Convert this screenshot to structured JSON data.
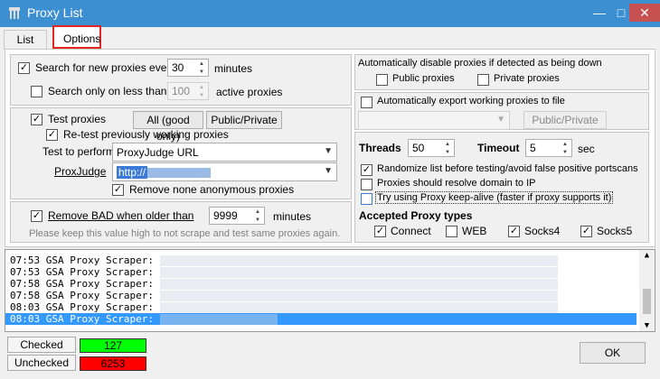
{
  "window": {
    "title": "Proxy List",
    "controls": [
      "minimize-icon",
      "maximize-icon",
      "close-icon"
    ],
    "titlebar_color": "#3c8fd1"
  },
  "tabs": [
    {
      "label": "List",
      "active": false
    },
    {
      "label": "Options",
      "active": true
    }
  ],
  "search": {
    "search_new_label": "Search for new proxies every",
    "search_new_checked": true,
    "search_new_value": "30",
    "search_new_unit": "minutes",
    "search_less_label": "Search only on less than",
    "search_less_checked": false,
    "search_less_value": "100",
    "search_less_unit": "active proxies"
  },
  "test": {
    "test_label": "Test proxies",
    "test_checked": true,
    "all_good_button": "All (good only)",
    "public_private_button": "Public/Private",
    "retest_label": "Re-test previously working proxies",
    "retest_checked": true,
    "test_to_perform_label": "Test to perform",
    "test_to_perform_value": "ProxyJudge URL",
    "proxyjudge_label": "ProxJudge",
    "proxyjudge_value": "http://",
    "remove_anon_label": "Remove none anonymous proxies",
    "remove_anon_checked": true
  },
  "remove_bad": {
    "label": "Remove BAD when older than",
    "checked": true,
    "value": "9999",
    "unit": "minutes",
    "hint": "Please keep this value high to not scrape and test same proxies again."
  },
  "auto_disable": {
    "label": "Automatically disable proxies if detected as being down",
    "public_label": "Public proxies",
    "public_checked": false,
    "private_label": "Private proxies",
    "private_checked": false
  },
  "auto_export": {
    "label": "Automatically export working proxies to file",
    "checked": false,
    "public_private_button": "Public/Private"
  },
  "threads": {
    "threads_label": "Threads",
    "threads_value": "50",
    "timeout_label": "Timeout",
    "timeout_value": "5",
    "timeout_unit": "sec"
  },
  "options": {
    "randomize_label": "Randomize list before testing/avoid false positive portscans",
    "randomize_checked": true,
    "resolve_label": "Proxies should resolve domain to IP",
    "resolve_checked": false,
    "keepalive_label": "Try using Proxy keep-alive (faster if proxy supports it)",
    "keepalive_checked": false
  },
  "accepted_types": {
    "title": "Accepted Proxy types",
    "connect_label": "Connect",
    "connect_checked": true,
    "web_label": "WEB",
    "web_checked": false,
    "socks4_label": "Socks4",
    "socks4_checked": true,
    "socks5_label": "Socks5",
    "socks5_checked": true
  },
  "log": {
    "lines": [
      "07:53 GSA Proxy Scraper:",
      "07:53 GSA Proxy Scraper:",
      "07:58 GSA Proxy Scraper:",
      "07:58 GSA Proxy Scraper:",
      "08:03 GSA Proxy Scraper:",
      "08:03 GSA Proxy Scraper:"
    ],
    "selected_index": 5,
    "selection_color": "#3399ff"
  },
  "stats": {
    "checked_label": "Checked",
    "checked_value": "127",
    "checked_color": "#00ff00",
    "unchecked_label": "Unchecked",
    "unchecked_value": "6253",
    "unchecked_color": "#ff0000"
  },
  "ok_button": "OK"
}
